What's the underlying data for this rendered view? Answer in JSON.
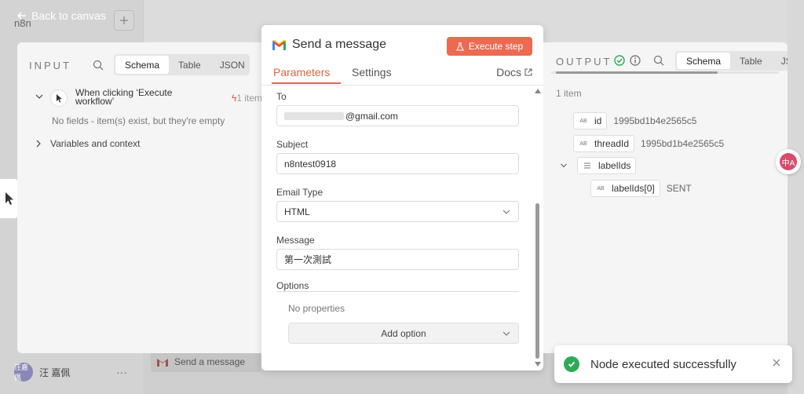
{
  "canvas": {
    "back_label": "Back to canvas",
    "logo_text": "n8n",
    "bottom_node_label": "Send a message",
    "user_initials": "汪嘉佩",
    "user_name": "汪 嘉佩",
    "user_menu": "···"
  },
  "input": {
    "title": "INPUT",
    "tabs": [
      "Schema",
      "Table",
      "JSON"
    ],
    "active_tab": "Schema",
    "trigger_title": "When clicking ‘Execute workflow’",
    "trigger_count": "1 item",
    "no_fields_text": "No fields - item(s) exist, but they're empty",
    "variables_label": "Variables and context"
  },
  "node": {
    "title": "Send a message",
    "execute_label": "Execute step",
    "tabs": {
      "parameters": "Parameters",
      "settings": "Settings",
      "docs": "Docs"
    },
    "fields": {
      "to_label": "To",
      "to_value": "@gmail.com",
      "subject_label": "Subject",
      "subject_value": "n8ntest0918",
      "email_type_label": "Email Type",
      "email_type_value": "HTML",
      "message_label": "Message",
      "message_value": "第一次測試",
      "options_label": "Options",
      "no_properties": "No properties",
      "add_option_label": "Add option"
    }
  },
  "output": {
    "title": "OUTPUT",
    "tabs": [
      "Schema",
      "Table",
      "JS"
    ],
    "active_tab": "Schema",
    "items_count": "1 item",
    "type_badge": "AB",
    "rows": [
      {
        "key": "id",
        "value": "1995bd1b4e2565c5"
      },
      {
        "key": "threadId",
        "value": "1995bd1b4e2565c5"
      },
      {
        "key": "labelIds",
        "value": ""
      },
      {
        "key": "labelIds[0]",
        "value": "SENT"
      }
    ]
  },
  "toast": {
    "message": "Node executed successfully"
  },
  "translate_glyph": "中A",
  "colors": {
    "accent": "#e8623f",
    "execute_bg": "#ec6a52",
    "success": "#2faa59",
    "bolt": "#e54d42"
  }
}
